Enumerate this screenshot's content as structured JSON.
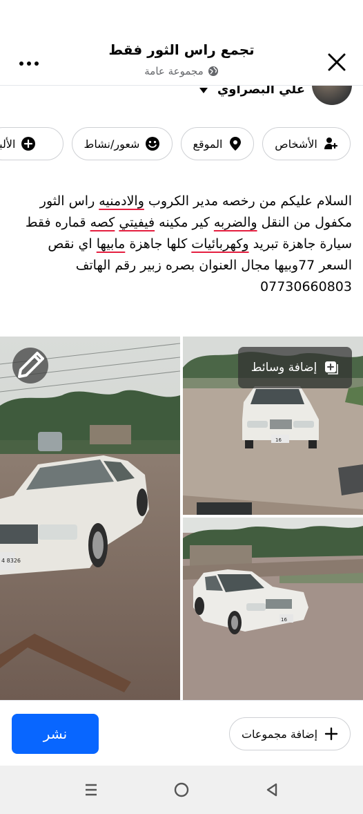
{
  "header": {
    "title": "تجمع راس الثور فقط",
    "subtitle": "مجموعة عامة",
    "more_icon": "more-horizontal-icon",
    "close_icon": "close-icon"
  },
  "author": {
    "name": "علي البصراوي"
  },
  "chips": [
    {
      "label": "الأشخاص",
      "icon": "tag-people-icon"
    },
    {
      "label": "الموقع",
      "icon": "location-pin-icon"
    },
    {
      "label": "شعور/نشاط",
      "icon": "smiley-icon"
    },
    {
      "label": "الألبوم",
      "icon": "add-circle-icon"
    }
  ],
  "post": {
    "segments": [
      "السلام عليكم من رخصه مدير الكروب ",
      "والادمنيه",
      " راس الثور مكفول من النقل ",
      "والضربه",
      " كير مكينه ",
      "فيفيتي",
      " ",
      "كصه",
      " قماره فقط سيارة جاهزة تبريد ",
      "وكهربائيات",
      " كلها جاهزة ",
      "مابيها",
      " اي نقص السعر 77وبيها مجال العنوان بصره زبير رقم الهاتف 07730660803"
    ]
  },
  "media": {
    "add_media_label": "إضافة وسائط",
    "edit_icon": "pencil-icon",
    "photos": [
      {
        "name": "car-photo-front",
        "plate": "4 8326"
      },
      {
        "name": "car-photo-front-2",
        "plate": "16"
      },
      {
        "name": "car-photo-side",
        "plate": "16"
      }
    ]
  },
  "footer": {
    "publish_label": "نشر",
    "add_groups_label": "إضافة مجموعات"
  },
  "system_nav": {
    "recent_icon": "recent-apps-icon",
    "home_icon": "home-circle-icon",
    "back_icon": "back-triangle-icon"
  },
  "colors": {
    "primary": "#0866ff",
    "spellcheck_underline": "#e41e3f",
    "secondary_text": "#65676b"
  }
}
